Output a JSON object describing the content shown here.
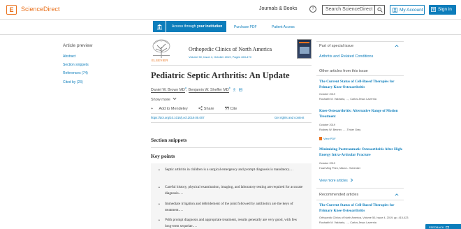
{
  "header": {
    "logo_glyph": "E",
    "brand": "ScienceDirect",
    "journals_books": "Journals & Books",
    "help_glyph": "?",
    "search_placeholder": "Search ScienceDirect",
    "my_account": "My Account",
    "sign_in": "Sign in"
  },
  "toolbar": {
    "access_prefix": "Access through ",
    "access_bold": "your institution",
    "purchase_pdf": "Purchase PDF",
    "patient_access": "Patient Access"
  },
  "left_nav": {
    "title": "Article preview",
    "items": [
      "Abstract",
      "Section snippets",
      "References (74)",
      "Cited by (23)"
    ]
  },
  "article": {
    "publisher_word": "ELSEVIER",
    "journal_title": "Orthopedic Clinics of North America",
    "journal_meta": "Volume 50, Issue 4, October 2019, Pages 463-470",
    "title": "Pediatric Septic Arthritis: An Update",
    "author1": "Daniel W. Brown MD",
    "author1_sup": "a",
    "sep": ",",
    "author2": "Benjamin W. Sheffer MD",
    "author2_sup": "b",
    "show_more": "Show more",
    "add_mendeley": "Add to Mendeley",
    "share": "Share",
    "cite": "Cite",
    "doi": "https://doi.org/10.1016/j.ocl.2019.05.007",
    "rights": "Get rights and content",
    "section_snippets": "Section snippets",
    "key_points_heading": "Key points",
    "key_points": [
      "Septic arthritis in children is a surgical emergency and prompt diagnosis is mandatory.…",
      "Careful history, physical examination, imaging, and laboratory testing are required for accurate diagnosis.…",
      "Immediate irrigation and débridement of the joint followed by antibiotics are the keys of treatment.…",
      "With prompt diagnosis and appropriate treatment, results generally are very good, with few long-term sequelae.…"
    ]
  },
  "sidebar": {
    "special_issue_heading": "Part of special issue",
    "special_issue_link": "Arthritis and Related Conditions",
    "other_articles_heading": "Other articles from this issue",
    "other_articles": [
      {
        "title": "The Current Status of Cell-Based Therapies for Primary Knee Osteoarthritis",
        "date": "October 2019",
        "authors": "Rushabh M. Vakharia, …, Carlos Jesus Lavernia"
      },
      {
        "title": "Knee Osteoarthritis: Alternative Range of Motion Treatment",
        "date": "October 2019",
        "authors": "Rodney W. Benner, …, Tinker Gray",
        "pdf": "View PDF"
      },
      {
        "title": "Minimizing Posttraumatic Osteoarthritis After High-Energy Intra-Articular Fracture",
        "date": "October 2019",
        "authors": "Huai Ming Phen, Mara L. Schenker"
      }
    ],
    "view_more": "View more articles",
    "recommended_heading": "Recommended articles",
    "recommended": [
      {
        "title": "The Current Status of Cell-Based Therapies for Primary Knee Osteoarthritis",
        "meta": "Orthopedic Clinics of North America, Volume 50, Issue 4, 2019, pp. 415-423",
        "authors": "Rushabh M. Vakharia, …, Carlos Jesus Lavernia"
      }
    ]
  },
  "feedback": "FEEDBACK",
  "colors": {
    "accent": "#0c7dbb",
    "brand": "#e9711c"
  }
}
